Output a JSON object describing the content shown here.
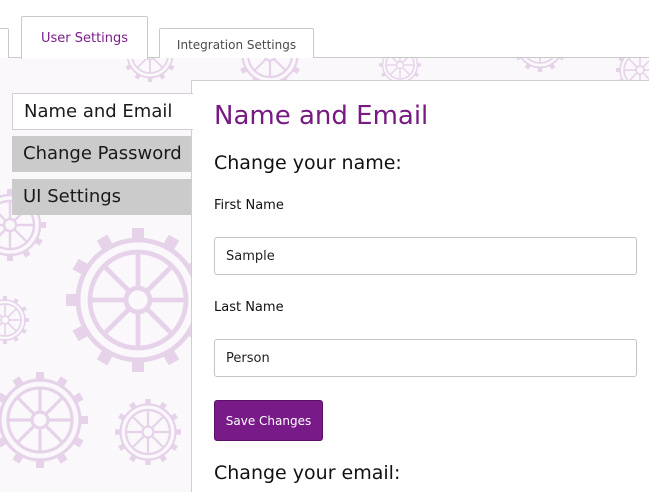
{
  "tabs": {
    "user_settings": "User Settings",
    "integration_settings": "Integration Settings"
  },
  "sidebar": {
    "items": [
      {
        "label": "Name and Email"
      },
      {
        "label": "Change Password"
      },
      {
        "label": "UI Settings"
      }
    ]
  },
  "main": {
    "title": "Name and Email",
    "change_name_heading": "Change your name:",
    "first_name": {
      "label": "First Name",
      "value": "Sample"
    },
    "last_name": {
      "label": "Last Name",
      "value": "Person"
    },
    "save_label": "Save Changes",
    "change_email_heading": "Change your email:"
  },
  "colors": {
    "accent": "#771a82",
    "gear": "#e6d3ea",
    "sidebar_inactive": "#cbcbcb"
  }
}
